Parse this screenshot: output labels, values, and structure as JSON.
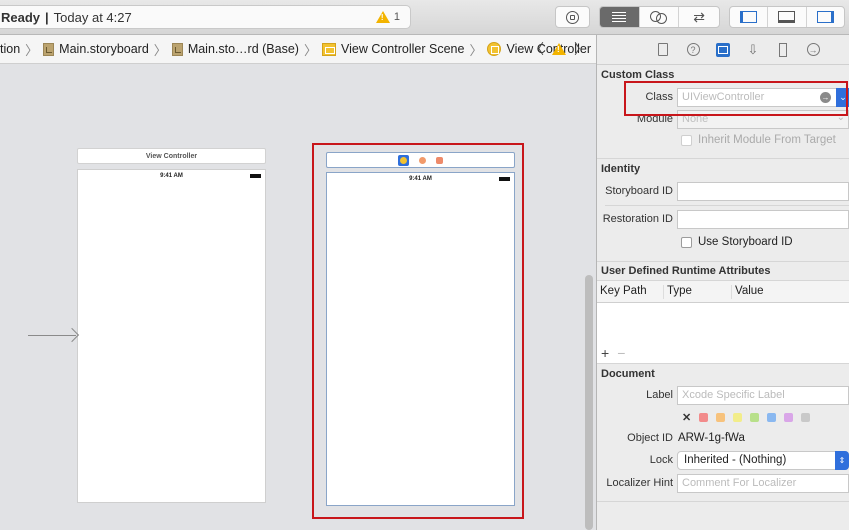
{
  "toolbar": {
    "status": "Ready",
    "separator": "|",
    "timestamp": "Today at 4:27",
    "warning_count": "1",
    "colors": {
      "selected_segment": "#6a6a6a",
      "accent": "#2a6fc9"
    }
  },
  "jumpbar": {
    "items": [
      {
        "label": "tion",
        "icon": "folder-icon"
      },
      {
        "label": "Main.storyboard",
        "icon": "storyboard-file-icon"
      },
      {
        "label": "Main.sto…rd (Base)",
        "icon": "storyboard-file-icon"
      },
      {
        "label": "View Controller Scene",
        "icon": "scene-icon"
      },
      {
        "label": "View Controller",
        "icon": "view-controller-icon"
      }
    ]
  },
  "canvas": {
    "scene1": {
      "title": "View Controller",
      "time": "9:41 AM"
    },
    "scene2": {
      "time": "9:41 AM"
    }
  },
  "inspector": {
    "tabs": [
      "file-icon",
      "help-icon",
      "identity-icon",
      "attributes-icon",
      "size-icon",
      "connections-icon"
    ],
    "custom_class": {
      "title": "Custom Class",
      "class_label": "Class",
      "class_placeholder": "UIViewController",
      "module_label": "Module",
      "module_placeholder": "None",
      "inherit_label": "Inherit Module From Target"
    },
    "identity": {
      "title": "Identity",
      "storyboard_id_label": "Storyboard ID",
      "storyboard_id_value": "",
      "restoration_id_label": "Restoration ID",
      "restoration_id_value": "",
      "use_storyboard_id_label": "Use Storyboard ID"
    },
    "runtime_attributes": {
      "title": "User Defined Runtime Attributes",
      "columns": [
        "Key Path",
        "Type",
        "Value"
      ],
      "rows": [],
      "add": "+",
      "remove": "−"
    },
    "document": {
      "title": "Document",
      "label_label": "Label",
      "label_placeholder": "Xcode Specific Label",
      "clear": "✕",
      "swatch_colors": [
        "#f28b8b",
        "#f7c27c",
        "#f2ed8a",
        "#b8e08a",
        "#8ab8f0",
        "#d9a6e8",
        "#c9c9c9"
      ],
      "object_id_label": "Object ID",
      "object_id_value": "ARW-1g-fWa",
      "lock_label": "Lock",
      "lock_value": "Inherited - (Nothing)",
      "localizer_hint_label": "Localizer Hint",
      "localizer_hint_placeholder": "Comment For Localizer"
    }
  }
}
